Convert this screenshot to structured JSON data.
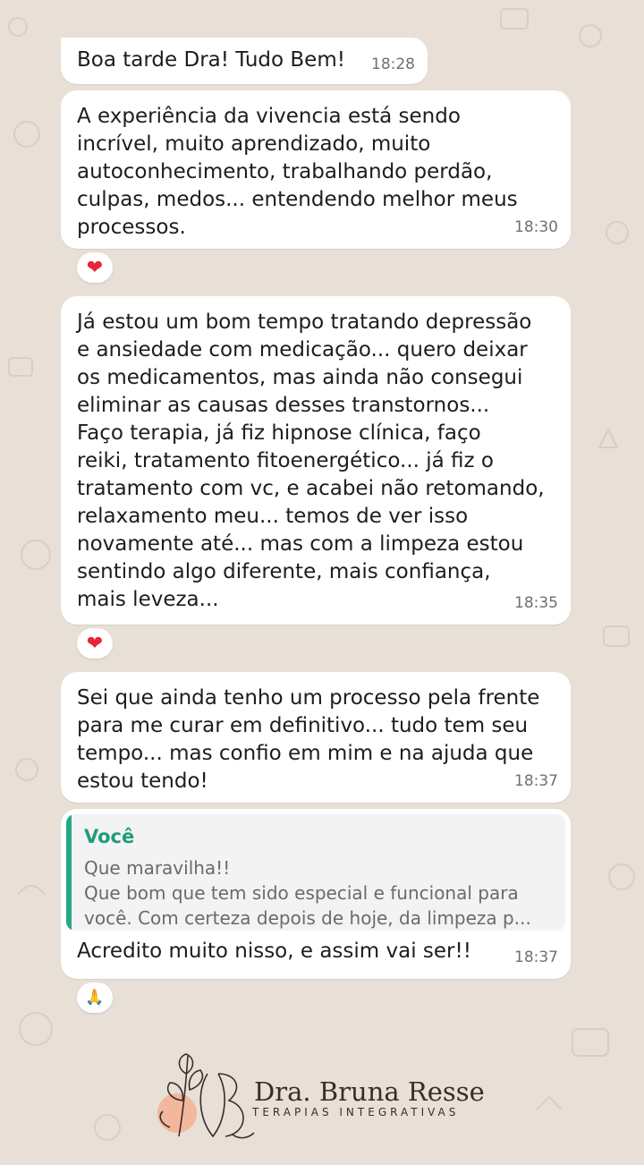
{
  "messages": [
    {
      "text": "Boa tarde Dra! Tudo Bem!",
      "time": "18:28"
    },
    {
      "text": "A experiência da vivencia está sendo\nincrível, muito aprendizado, muito\nautoconhecimento, trabalhando perdão,\nculpas, medos... entendendo melhor meus\nprocessos.",
      "time": "18:30",
      "reaction": "❤"
    },
    {
      "text": "Já estou um bom tempo tratando depressão\ne ansiedade com medicação... quero deixar\nos medicamentos, mas ainda não consegui\neliminar as causas desses transtornos...\nFaço terapia, já fiz hipnose clínica, faço\nreiki, tratamento fitoenergético... já fiz o\ntratamento com vc, e acabei não retomando,\nrelaxamento meu... temos de ver isso\nnovamente até... mas com a limpeza estou\nsentindo algo diferente, mais confiança,\nmais leveza...",
      "time": "18:35",
      "reaction": "❤"
    },
    {
      "text": "Sei que ainda tenho um processo pela frente\npara me curar em definitivo... tudo tem seu\ntempo... mas confio em mim e na ajuda que\nestou tendo!",
      "time": "18:37"
    },
    {
      "quote": {
        "author": "Você",
        "text": "Que maravilha!!\nQue bom que tem sido especial e funcional para\nvocê. Com certeza depois de hoje, da limpeza p..."
      },
      "text": "Acredito muito nisso, e assim vai ser!!",
      "time": "18:37",
      "reaction": "🙏"
    }
  ],
  "brand": {
    "name": "Dra. Bruna Resse",
    "tagline": "TERAPIAS INTEGRATIVAS"
  },
  "colors": {
    "background": "#e8dfd6",
    "bubble": "#ffffff",
    "quote_accent": "#25a884",
    "heart": "#e8233a"
  },
  "icons": {
    "heart_reaction": "heart-icon",
    "pray_reaction": "praying-hands-icon",
    "logo": "floral-logo-icon"
  }
}
